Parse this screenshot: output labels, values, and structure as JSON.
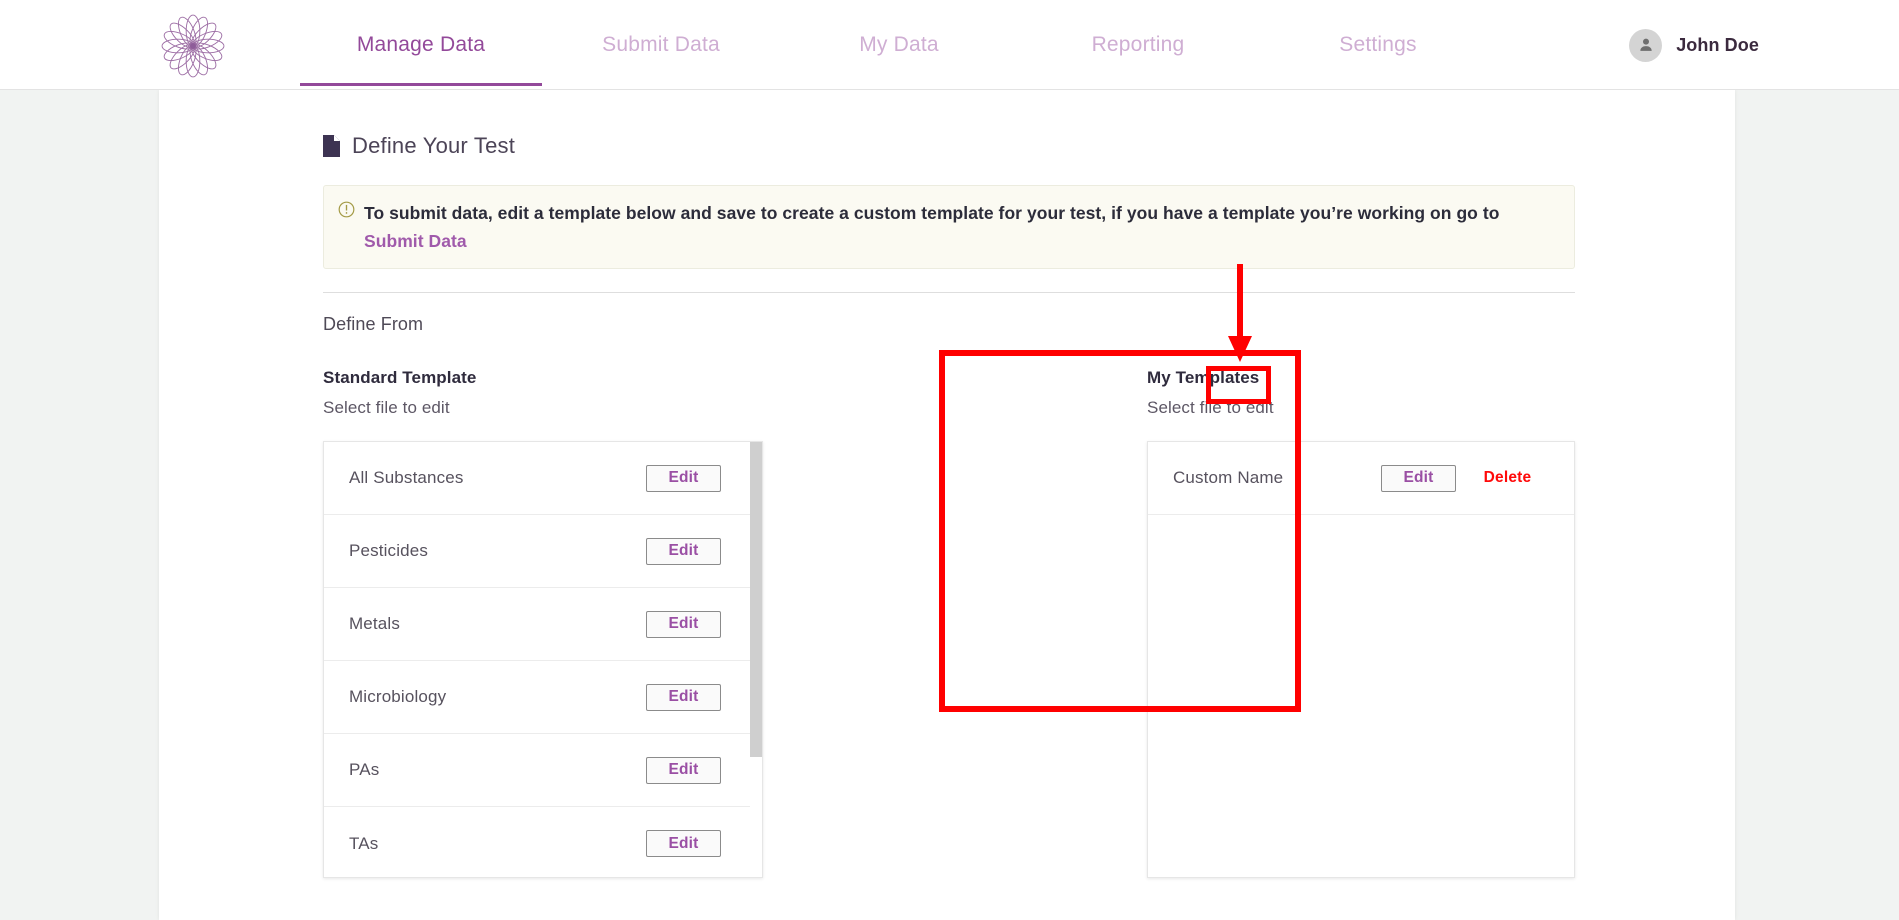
{
  "header": {
    "logo_name": "mandala-flower-logo",
    "brand_color": "#93499a",
    "tabs": [
      {
        "label": "Manage Data",
        "active": true
      },
      {
        "label": "Submit Data",
        "active": false
      },
      {
        "label": "My Data",
        "active": false
      },
      {
        "label": "Reporting",
        "active": false
      },
      {
        "label": "Settings",
        "active": false
      }
    ],
    "user": {
      "name": "John Doe",
      "avatar_icon": "person-icon"
    }
  },
  "page": {
    "title": "Define Your Test",
    "title_icon": "document-icon",
    "banner": {
      "icon": "info-circle-icon",
      "text_before": "To submit data, edit a template below and save to create a custom template for your test, if you have a template you’re working on go to ",
      "link_text": "Submit Data",
      "bg_color": "#fbfaf2",
      "icon_color": "#9b9343"
    },
    "define_from_label": "Define From"
  },
  "standard_templates": {
    "heading": "Standard Template",
    "subheading": "Select file to edit",
    "rows": [
      {
        "name": "All Substances",
        "action": "Edit"
      },
      {
        "name": "Pesticides",
        "action": "Edit"
      },
      {
        "name": "Metals",
        "action": "Edit"
      },
      {
        "name": "Microbiology",
        "action": "Edit"
      },
      {
        "name": "PAs",
        "action": "Edit"
      },
      {
        "name": "TAs",
        "action": "Edit"
      }
    ]
  },
  "my_templates": {
    "heading": "My Templates",
    "subheading": "Select file to edit",
    "rows": [
      {
        "name": "Custom Name",
        "edit_label": "Edit",
        "delete_label": "Delete"
      }
    ]
  },
  "annotations": {
    "color": "#ff0000",
    "arrow_name": "red-arrow-pointing-to-delete",
    "box_panel_name": "red-highlight-my-templates-panel",
    "box_delete_name": "red-highlight-delete-button"
  }
}
